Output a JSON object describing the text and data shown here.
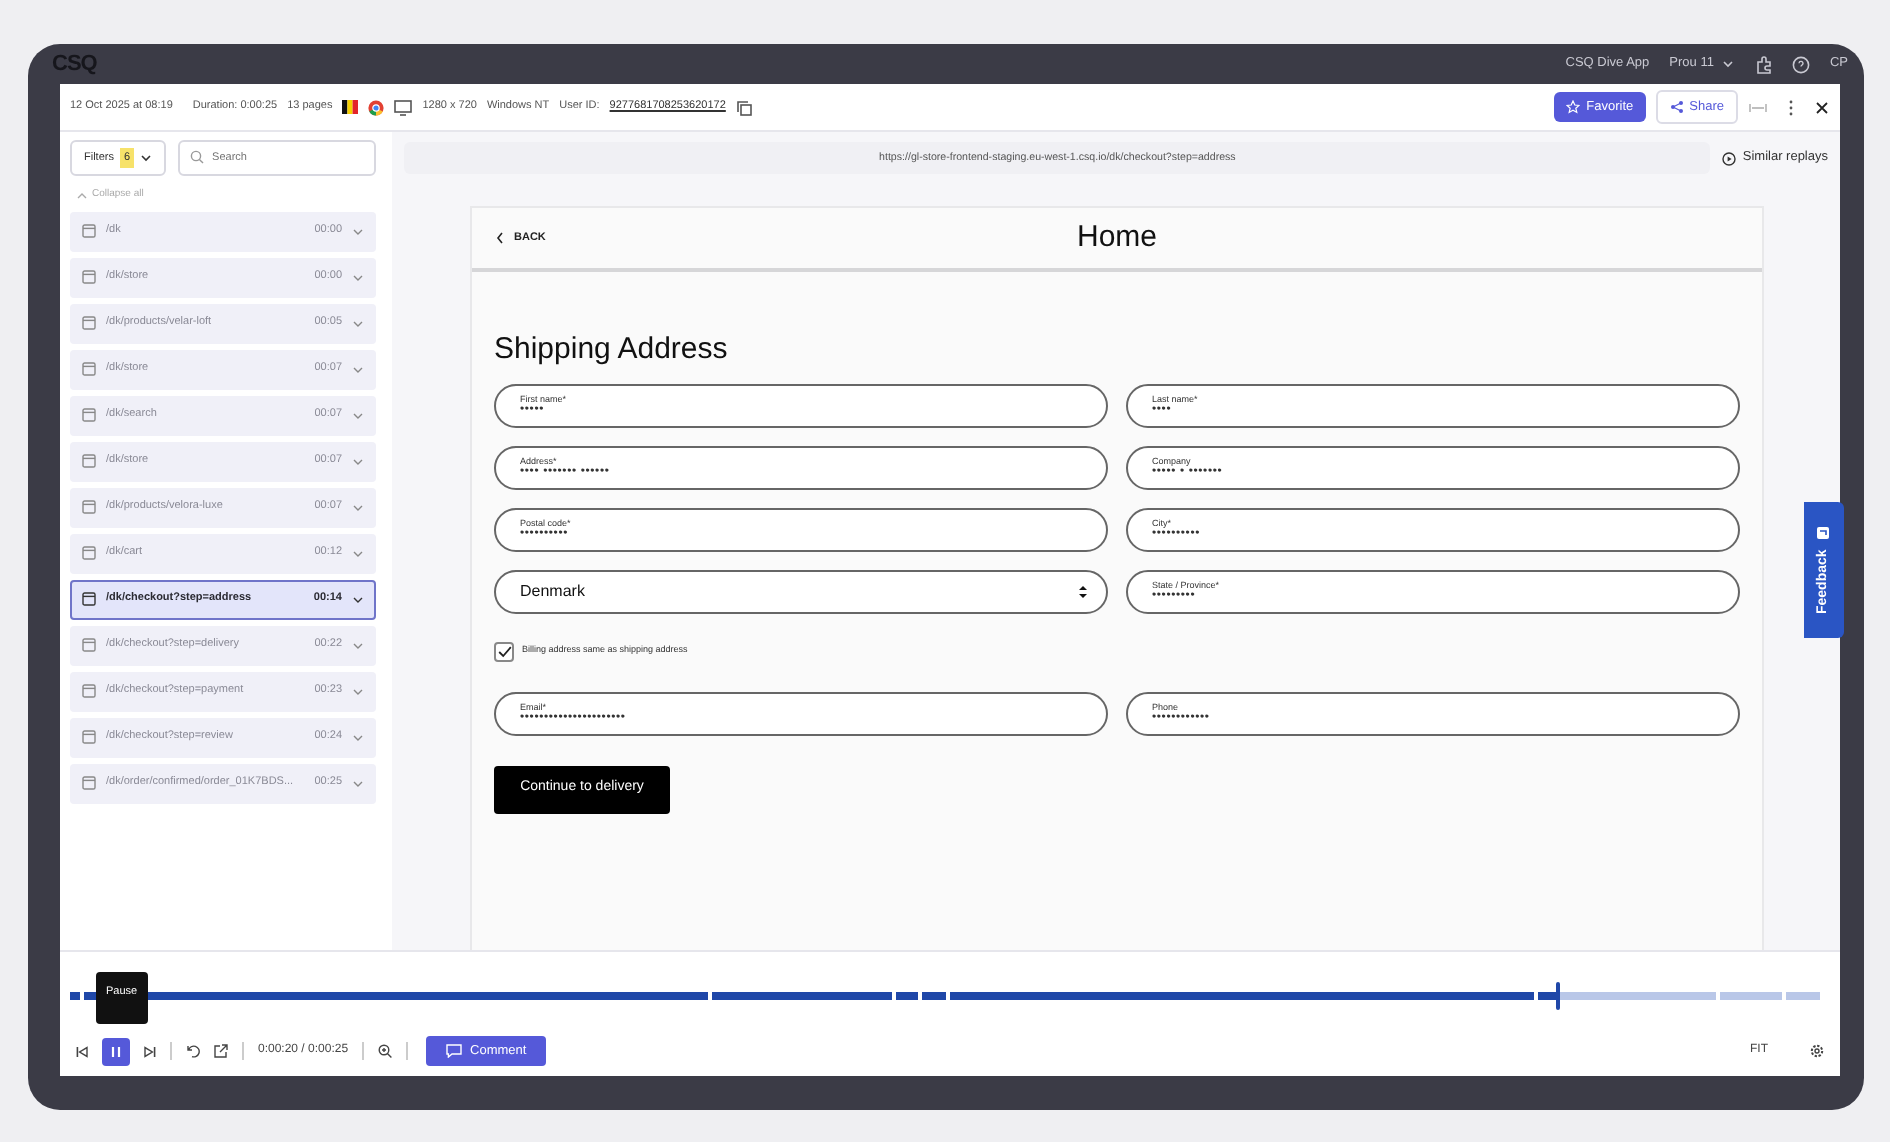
{
  "app_bar": {
    "logo": "CSQ",
    "account": "CSQ Dive App",
    "user_menu": "Prou 11",
    "avatar": "CP"
  },
  "session": {
    "date": "12 Oct 2025 at 08:19",
    "duration": "Duration: 0:00:25",
    "pages": "13 pages",
    "resolution": "1280 x 720",
    "os": "Windows NT",
    "user_id_label": "User ID:",
    "user_id": "9277681708253620172"
  },
  "actions": [
    {
      "kind": "favorite",
      "label": "Favorite"
    },
    {
      "kind": "share",
      "label": "Share"
    }
  ],
  "sidebar": {
    "filters": {
      "label": "Filters",
      "count": "6"
    },
    "search": {
      "placeholder": "Search"
    },
    "collapse": "Collapse all",
    "pages": [
      {
        "path": "/dk",
        "time": "00:00",
        "selected": false
      },
      {
        "path": "/dk/store",
        "time": "00:00",
        "selected": false
      },
      {
        "path": "/dk/products/velar-loft",
        "time": "00:05",
        "selected": false
      },
      {
        "path": "/dk/store",
        "time": "00:07",
        "selected": false
      },
      {
        "path": "/dk/search",
        "time": "00:07",
        "selected": false
      },
      {
        "path": "/dk/store",
        "time": "00:07",
        "selected": false
      },
      {
        "path": "/dk/products/velora-luxe",
        "time": "00:07",
        "selected": false
      },
      {
        "path": "/dk/cart",
        "time": "00:12",
        "selected": false
      },
      {
        "path": "/dk/checkout?step=address",
        "time": "00:14",
        "selected": true
      },
      {
        "path": "/dk/checkout?step=delivery",
        "time": "00:22",
        "selected": false
      },
      {
        "path": "/dk/checkout?step=payment",
        "time": "00:23",
        "selected": false
      },
      {
        "path": "/dk/checkout?step=review",
        "time": "00:24",
        "selected": false
      },
      {
        "path": "/dk/order/confirmed/order_01K7BDS...",
        "time": "00:25",
        "selected": false
      }
    ]
  },
  "url_bar": {
    "url": "https://gl-store-frontend-staging.eu-west-1.csq.io/dk/checkout?step=address",
    "similar": "Similar replays"
  },
  "replay": {
    "back": "BACK",
    "title": "Home",
    "heading": "Shipping Address",
    "fields": [
      {
        "kind": "text",
        "label": "First name*",
        "value": "•••••"
      },
      {
        "kind": "text",
        "label": "Last name*",
        "value": "••••"
      },
      {
        "kind": "text",
        "label": "Address*",
        "value": "•••• ••••••• ••••••"
      },
      {
        "kind": "text",
        "label": "Company",
        "value": "••••• • •••••••"
      },
      {
        "kind": "text",
        "label": "Postal code*",
        "value": "••••••••••"
      },
      {
        "kind": "text",
        "label": "City*",
        "value": "••••••••••"
      },
      {
        "kind": "select",
        "value": "Denmark"
      },
      {
        "kind": "text",
        "label": "State / Province*",
        "value": "•••••••••"
      }
    ],
    "billing": {
      "label": "Billing address same as shipping address",
      "checked": true
    },
    "contact_fields": [
      {
        "kind": "text",
        "label": "Email*",
        "value": "••••••••••••••••••••••"
      },
      {
        "kind": "text",
        "label": "Phone",
        "value": "••••••••••••"
      }
    ],
    "submit": "Continue to delivery",
    "feedback": "Feedback"
  },
  "player": {
    "playing": true,
    "tooltip": "Pause",
    "level": 0.85,
    "time": "0:00:20 / 0:00:25",
    "comment": "Comment",
    "fit": "FIT"
  }
}
